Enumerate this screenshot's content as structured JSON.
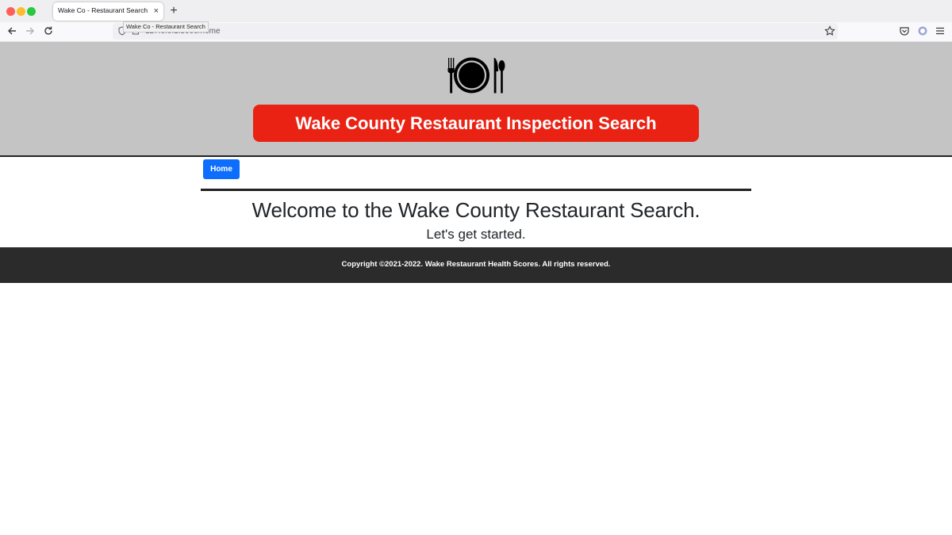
{
  "browser": {
    "tab_title": "Wake Co - Restaurant Search",
    "tab_close": "×",
    "new_tab": "+",
    "url": "127.0.0.1:5000/home",
    "tooltip": "Wake Co - Restaurant Search"
  },
  "header": {
    "logo_icon": "plate-fork-knife-spoon-icon",
    "title": "Wake County Restaurant Inspection Search",
    "banner_color": "#ea2214",
    "background_color": "#c4c4c4"
  },
  "nav": {
    "home_label": "Home",
    "home_color": "#0d6efd"
  },
  "main": {
    "welcome": "Welcome to the Wake County Restaurant Search.",
    "subtitle": "Let's get started."
  },
  "footer": {
    "copyright": "Copyright ©2021-2022. Wake Restaurant Health Scores. All rights reserved.",
    "background_color": "#2b2b2b"
  }
}
